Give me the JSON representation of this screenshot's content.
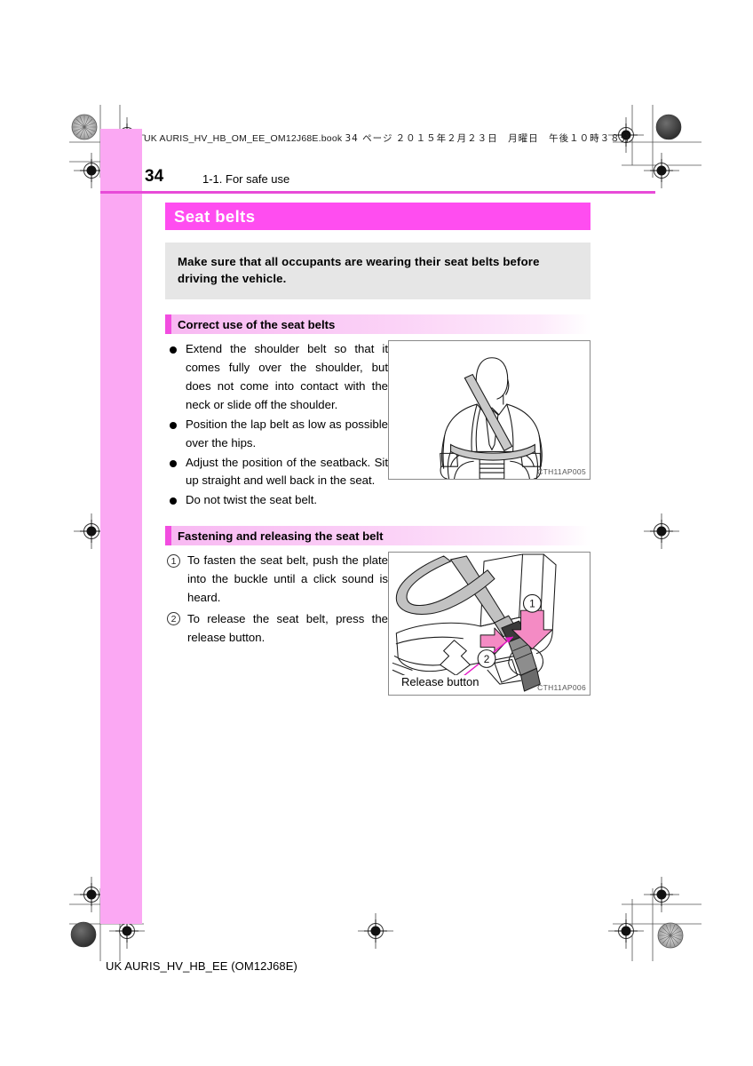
{
  "header": {
    "book_code": "UK AURIS_HV_HB_OM_EE_OM12J68E.book",
    "page_marker": "34 ページ",
    "date_jp": "２０１５年２月２３日　月曜日　午後１０時３８分",
    "page_number": "34",
    "section_crumb": "1-1. For safe use"
  },
  "title": "Seat belts",
  "callout": "Make sure that all occupants are wearing their seat belts before driving the vehicle.",
  "sections": [
    {
      "heading": "Correct use of the seat belts",
      "bullets": [
        "Extend the shoulder belt so that it comes fully over the shoulder, but does not come into contact with the neck or slide off the shoulder.",
        "Position the lap belt as low as possible over the hips.",
        "Adjust the position of the seatback. Sit up straight and well back in the seat.",
        "Do not twist the seat belt."
      ],
      "figure": {
        "code": "CTH11AP005",
        "alt": "occupant-wearing-seatbelt-illustration"
      }
    },
    {
      "heading": "Fastening and releasing the seat belt",
      "steps": [
        {
          "num": "1",
          "text": "To fasten the seat belt, push the plate into the buckle until a click sound is heard."
        },
        {
          "num": "2",
          "text": "To release the seat belt, press the release button."
        }
      ],
      "figure": {
        "code": "CTH11AP006",
        "label": "Release button",
        "callout_1": "1",
        "callout_2": "2",
        "alt": "seat-belt-buckle-release-illustration"
      }
    }
  ],
  "footer": "UK AURIS_HV_HB_EE (OM12J68E)",
  "colors": {
    "title_bar": "#FF4DF0",
    "accent_rule": "#E84BD8",
    "bleed_bar": "#FBA8F3",
    "subhead_accent": "#F24DE0",
    "callout_bg": "#E6E6E6",
    "arrow_pink": "#F48BC4"
  }
}
